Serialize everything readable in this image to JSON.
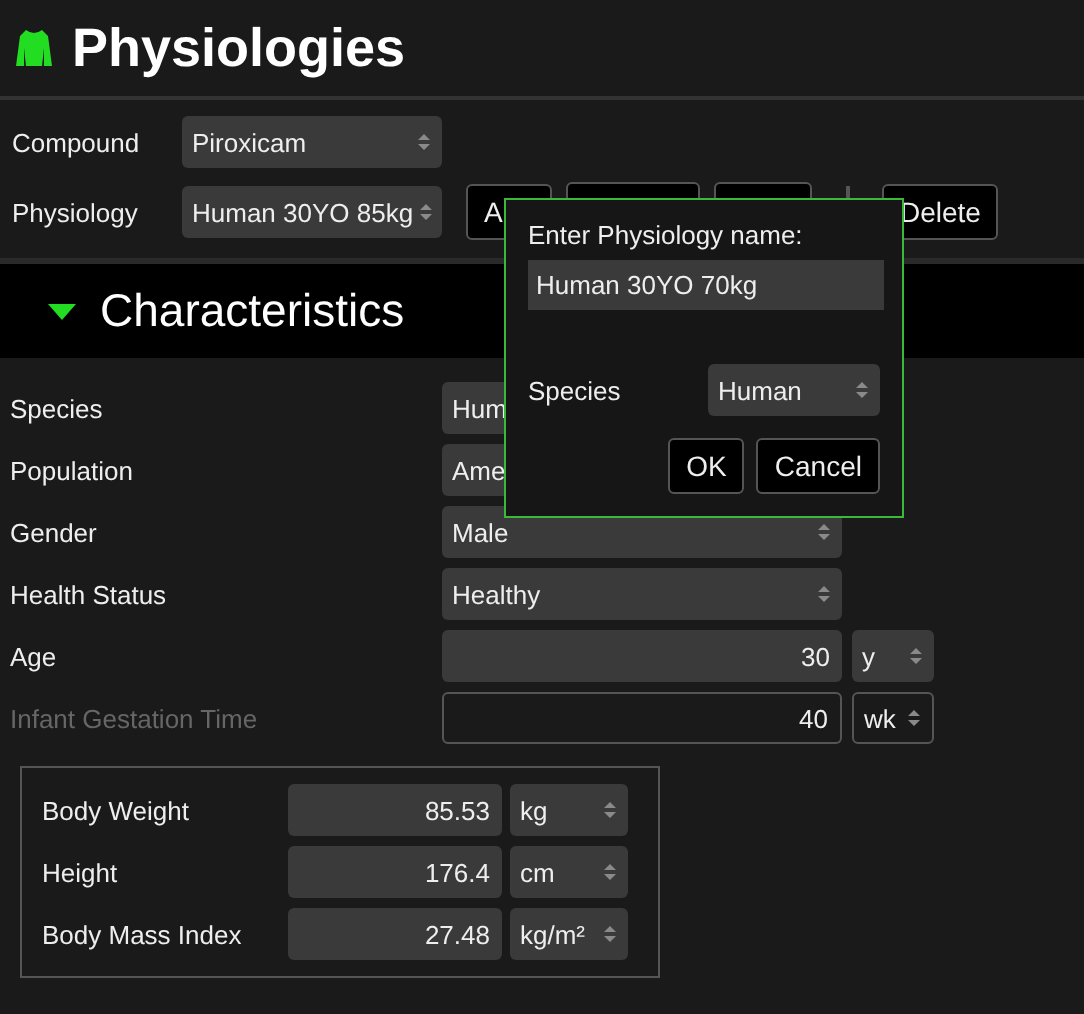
{
  "header": {
    "title": "Physiologies"
  },
  "selectors": [
    {
      "label": "Compound",
      "value": "Piroxicam"
    },
    {
      "label": "Physiology",
      "value": "Human 30YO 85kg"
    }
  ],
  "toolbar": [
    {
      "kind": "button",
      "label": "A"
    },
    {
      "kind": "button"
    },
    {
      "kind": "button"
    },
    {
      "kind": "separator"
    },
    {
      "kind": "button",
      "label": "Delete"
    }
  ],
  "section": {
    "title": "Characteristics",
    "expanded": true
  },
  "characteristics": [
    {
      "kind": "select",
      "label": "Species",
      "value": "Hum",
      "disabled": false
    },
    {
      "kind": "select",
      "label": "Population",
      "value": "Ame",
      "disabled": false
    },
    {
      "kind": "select",
      "label": "Gender",
      "value": "Male",
      "disabled": false
    },
    {
      "kind": "select",
      "label": "Health Status",
      "value": "Healthy",
      "disabled": false
    },
    {
      "kind": "number",
      "label": "Age",
      "value": "30",
      "unit": "y",
      "disabled": false
    },
    {
      "kind": "number",
      "label": "Infant Gestation Time",
      "value": "40",
      "unit": "wk",
      "disabled": true
    }
  ],
  "body_measures": [
    {
      "label": "Body Weight",
      "value": "85.53",
      "unit": "kg"
    },
    {
      "label": "Height",
      "value": "176.4",
      "unit": "cm"
    },
    {
      "label": "Body Mass Index",
      "value": "27.48",
      "unit": "kg/m²"
    }
  ],
  "dialog": {
    "prompt": "Enter Physiology name:",
    "name_value": "Human 30YO 70kg",
    "species_label": "Species",
    "species_value": "Human",
    "buttons": [
      "OK",
      "Cancel"
    ]
  }
}
